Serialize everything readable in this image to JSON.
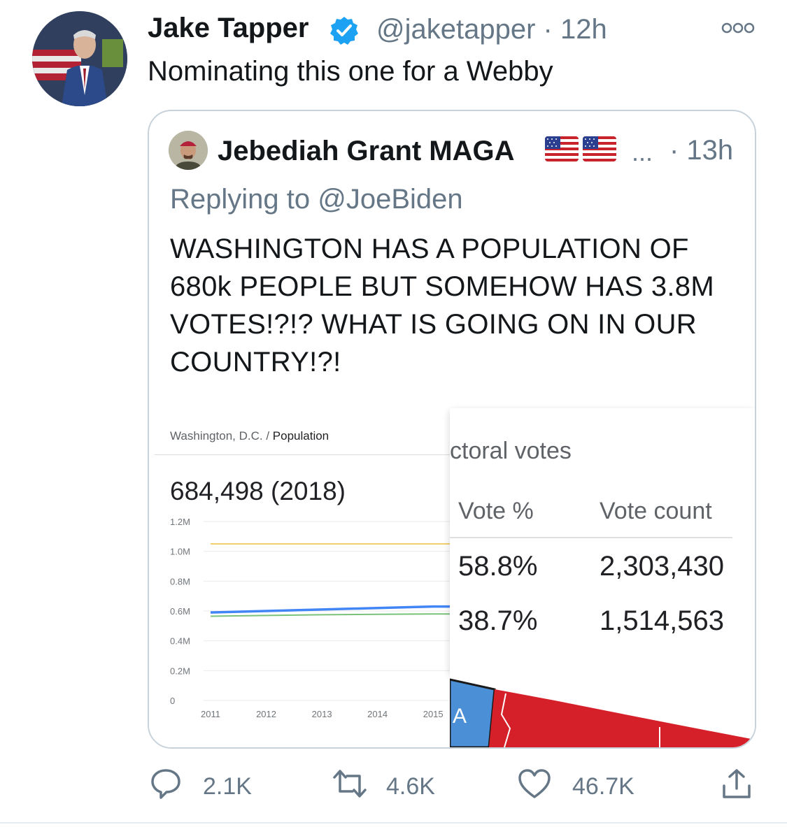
{
  "tweet": {
    "author_name": "Jake Tapper",
    "handle": "@jaketapper",
    "separator": "·",
    "time": "12h",
    "text": "Nominating this one for a Webby",
    "colors": {
      "verified": "#1da1f2",
      "secondary_text": "#657786"
    }
  },
  "quoted_tweet": {
    "author_name": "Jebediah Grant MAGA",
    "ellipsis": "...",
    "time": "· 13h",
    "replying_prefix": "Replying to",
    "replying_to": "@JoeBiden",
    "text": "WASHINGTON HAS A POPULATION OF 680k PEOPLE BUT SOMEHOW HAS 3.8M VOTES!?!? WHAT IS GOING ON IN OUR COUNTRY!?!"
  },
  "population_card": {
    "breadcrumb_place": "Washington, D.C.",
    "breadcrumb_sep": "/",
    "breadcrumb_topic": "Population",
    "value": "684,498 (2018)"
  },
  "chart_data": {
    "type": "line",
    "x": [
      2011,
      2012,
      2013,
      2014,
      2015
    ],
    "xlim": [
      2011,
      2015.4
    ],
    "ylim": [
      0,
      1.2
    ],
    "yticks": [
      "0",
      "0.2M",
      "0.4M",
      "0.6M",
      "0.8M",
      "1.0M",
      "1.2M"
    ],
    "xticks": [
      "2011",
      "2012",
      "2013",
      "2014",
      "2015"
    ],
    "series": [
      {
        "color": "#4285f4",
        "values": [
          0.59,
          0.6,
          0.61,
          0.62,
          0.63
        ]
      },
      {
        "color": "#7ac27a",
        "values": [
          0.565,
          0.57,
          0.575,
          0.578,
          0.58
        ]
      },
      {
        "color": "#f2cf6e",
        "values": [
          1.05,
          1.05,
          1.05,
          1.05,
          1.05
        ]
      }
    ]
  },
  "votes_card": {
    "title": "ctoral votes",
    "headers": [
      "Vote %",
      "Vote count"
    ],
    "rows": [
      [
        "58.8%",
        "2,303,430"
      ],
      [
        "38.7%",
        "1,514,563"
      ]
    ],
    "map_letter": "A",
    "colors": {
      "blue": "#4b8fd6",
      "red": "#d52029"
    }
  },
  "actions": {
    "reply_count": "2.1K",
    "retweet_count": "4.6K",
    "like_count": "46.7K",
    "icons": [
      "reply-icon",
      "retweet-icon",
      "like-icon",
      "share-icon"
    ]
  }
}
